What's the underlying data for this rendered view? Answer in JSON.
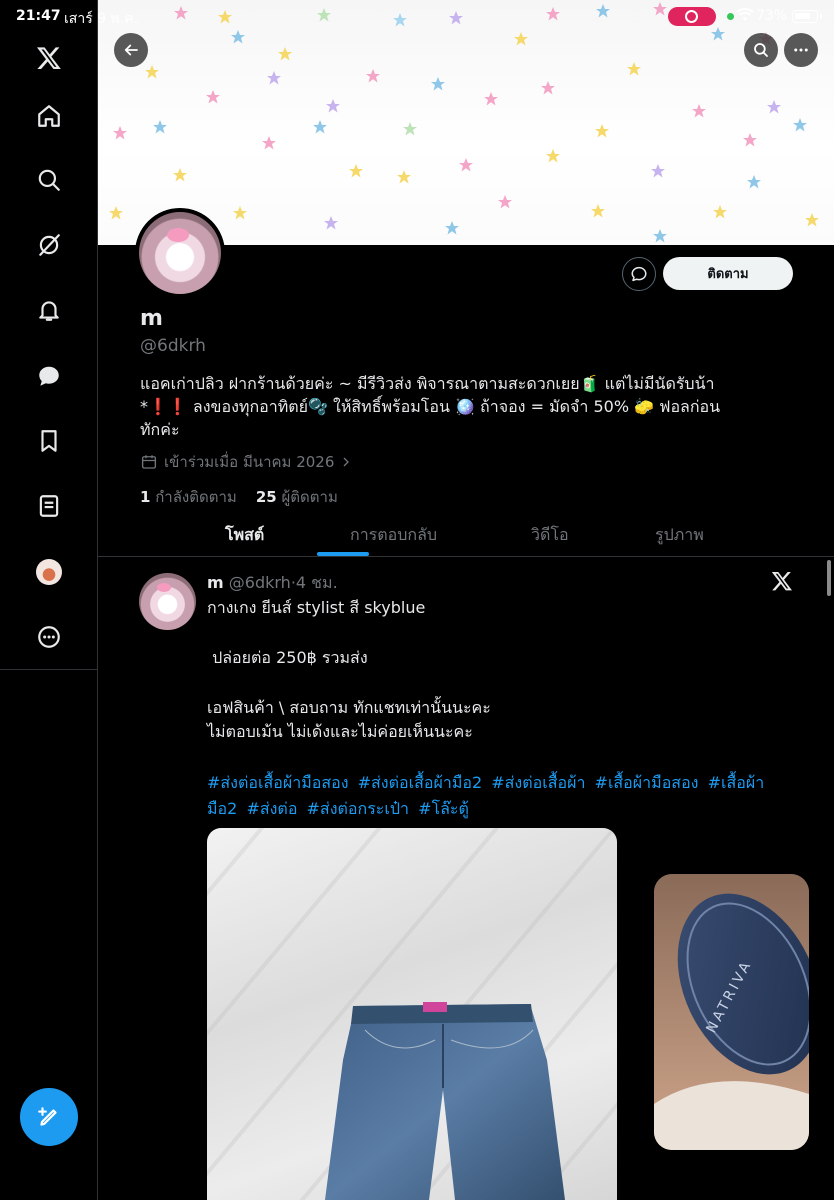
{
  "status_bar": {
    "time": "21:47",
    "date": "เสาร์ 9 พ.ค.",
    "battery": "73%"
  },
  "nav": {
    "items": [
      "x-logo-icon",
      "home-icon",
      "search-icon",
      "grok-icon",
      "notifications-icon",
      "messages-icon",
      "bookmarks-icon",
      "lists-icon",
      "profile-avatar",
      "more-icon"
    ]
  },
  "profile": {
    "display_name": "m",
    "handle": "@6dkrh",
    "follow_label": "ติดตาม",
    "bio_line1": "แอคเก่าปลิว ฝากร้านด้วยค่ะ ~ มีรีวิวส่ง พิจารณาตามสะดวกเยย🧃 แต่ไม่มีนัดรับน้า",
    "bio_line2": "*❗️❗️ ลงของทุกอาทิตย์🫧 ให้สิทธิ์พร้อมโอน 🪩 ถ้าจอง = มัดจำ 50% 🧽 ฟอลก่อน",
    "bio_line3": "ทักค่ะ",
    "joined": "เข้าร่วมเมื่อ มีนาคม 2026",
    "following_count": "1",
    "following_label": "กำลังติดตาม",
    "followers_count": "25",
    "followers_label": "ผู้ติดตาม"
  },
  "tabs": [
    "โพสต์",
    "การตอบกลับ",
    "วิดีโอ",
    "รูปภาพ"
  ],
  "post": {
    "name": "m",
    "handle": "@6dkrh",
    "time": "4 ชม.",
    "line1": "กางเกง ยีนส์ stylist สี skyblue",
    "line2": " ปล่อยต่อ 250฿ รวมส่ง",
    "line3": "เอฟสินค้า \\ สอบถาม ทักแชทเท่านั้นนะคะ",
    "line4": "ไม่ตอบเม้น ไม่เด้งและไม่ค่อยเห็นนะคะ",
    "hashtags": [
      "#ส่งต่อเสื้อผ้ามือสอง",
      "#ส่งต่อเสื้อผ้ามือ2",
      "#ส่งต่อเสื้อผ้า",
      "#เสื้อผ้ามือสอง",
      "#เสื้อผ้ามือ2",
      "#ส่งต่อ",
      "#ส่งต่อกระเป๋า",
      "#โล๊ะตู้"
    ]
  },
  "pip_label": "NATRIVA",
  "colors": {
    "accent": "#1d9bf0",
    "background": "#000000",
    "muted": "#71767b"
  }
}
